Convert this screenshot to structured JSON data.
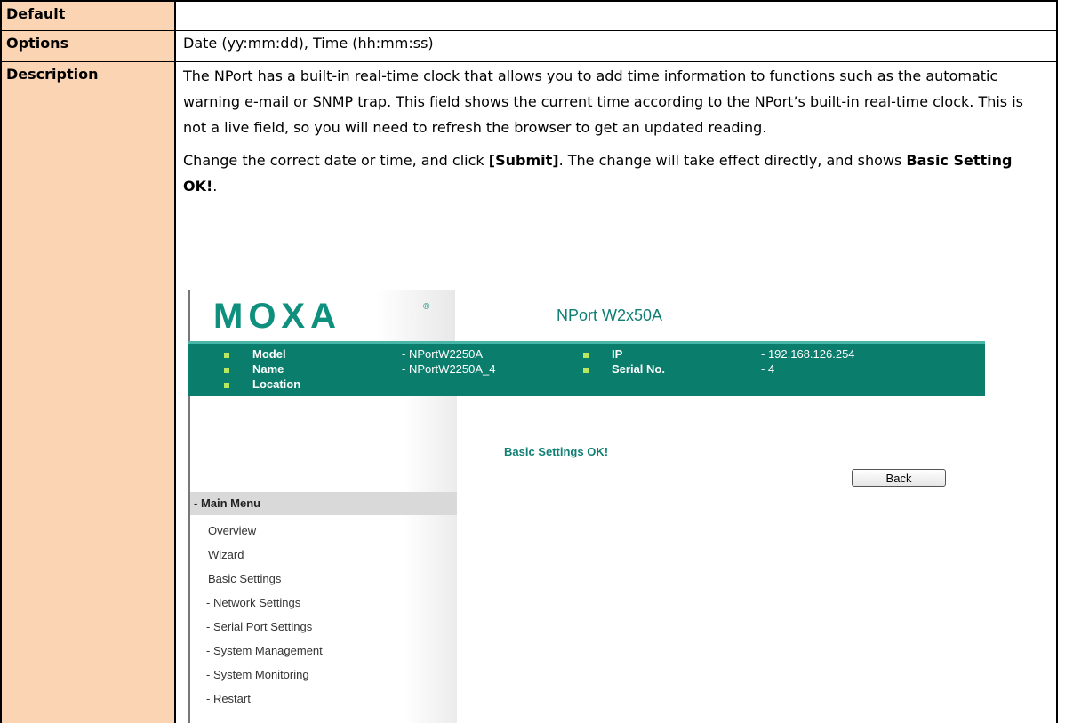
{
  "table": {
    "rows": [
      {
        "label": "Default",
        "value": ""
      },
      {
        "label": "Options",
        "value": "Date (yy:mm:dd), Time (hh:mm:ss)"
      },
      {
        "label": "Description"
      }
    ],
    "description": {
      "p1": "The NPort has a built-in real-time clock that allows you to add time information to functions such as the automatic warning e-mail or SNMP trap. This field shows the current time according to the NPort’s built-in real-time clock. This is not a live field, so you will need to refresh the browser to get an updated reading.",
      "p2_prefix": "Change the correct date or time, and click ",
      "p2_button": "[Submit]",
      "p2_mid": ". The change will take effect directly, and shows ",
      "p2_msg": "Basic Setting OK!",
      "p2_suffix": "."
    }
  },
  "screenshot": {
    "logo": "MOXA",
    "logo_mark": "®",
    "product": "NPort W2x50A",
    "info": {
      "model_label": "Model",
      "model_value": "- NPortW2250A",
      "name_label": "Name",
      "name_value": "- NPortW2250A_4",
      "location_label": "Location",
      "location_value": "-",
      "ip_label": "IP",
      "ip_value": "- 192.168.126.254",
      "serial_label": "Serial No.",
      "serial_value": "- 4"
    },
    "message": "Basic Settings OK!",
    "back_button": "Back",
    "menu_header": "- Main Menu",
    "menu_items": [
      "Overview",
      "Wizard",
      "Basic Settings",
      "- Network Settings",
      "- Serial Port Settings",
      "- System Management",
      "- System Monitoring",
      "- Restart"
    ],
    "colors": {
      "brand": "#0b7d6c",
      "bullet": "#b8e860",
      "header_cell": "#fbd4b4"
    }
  }
}
